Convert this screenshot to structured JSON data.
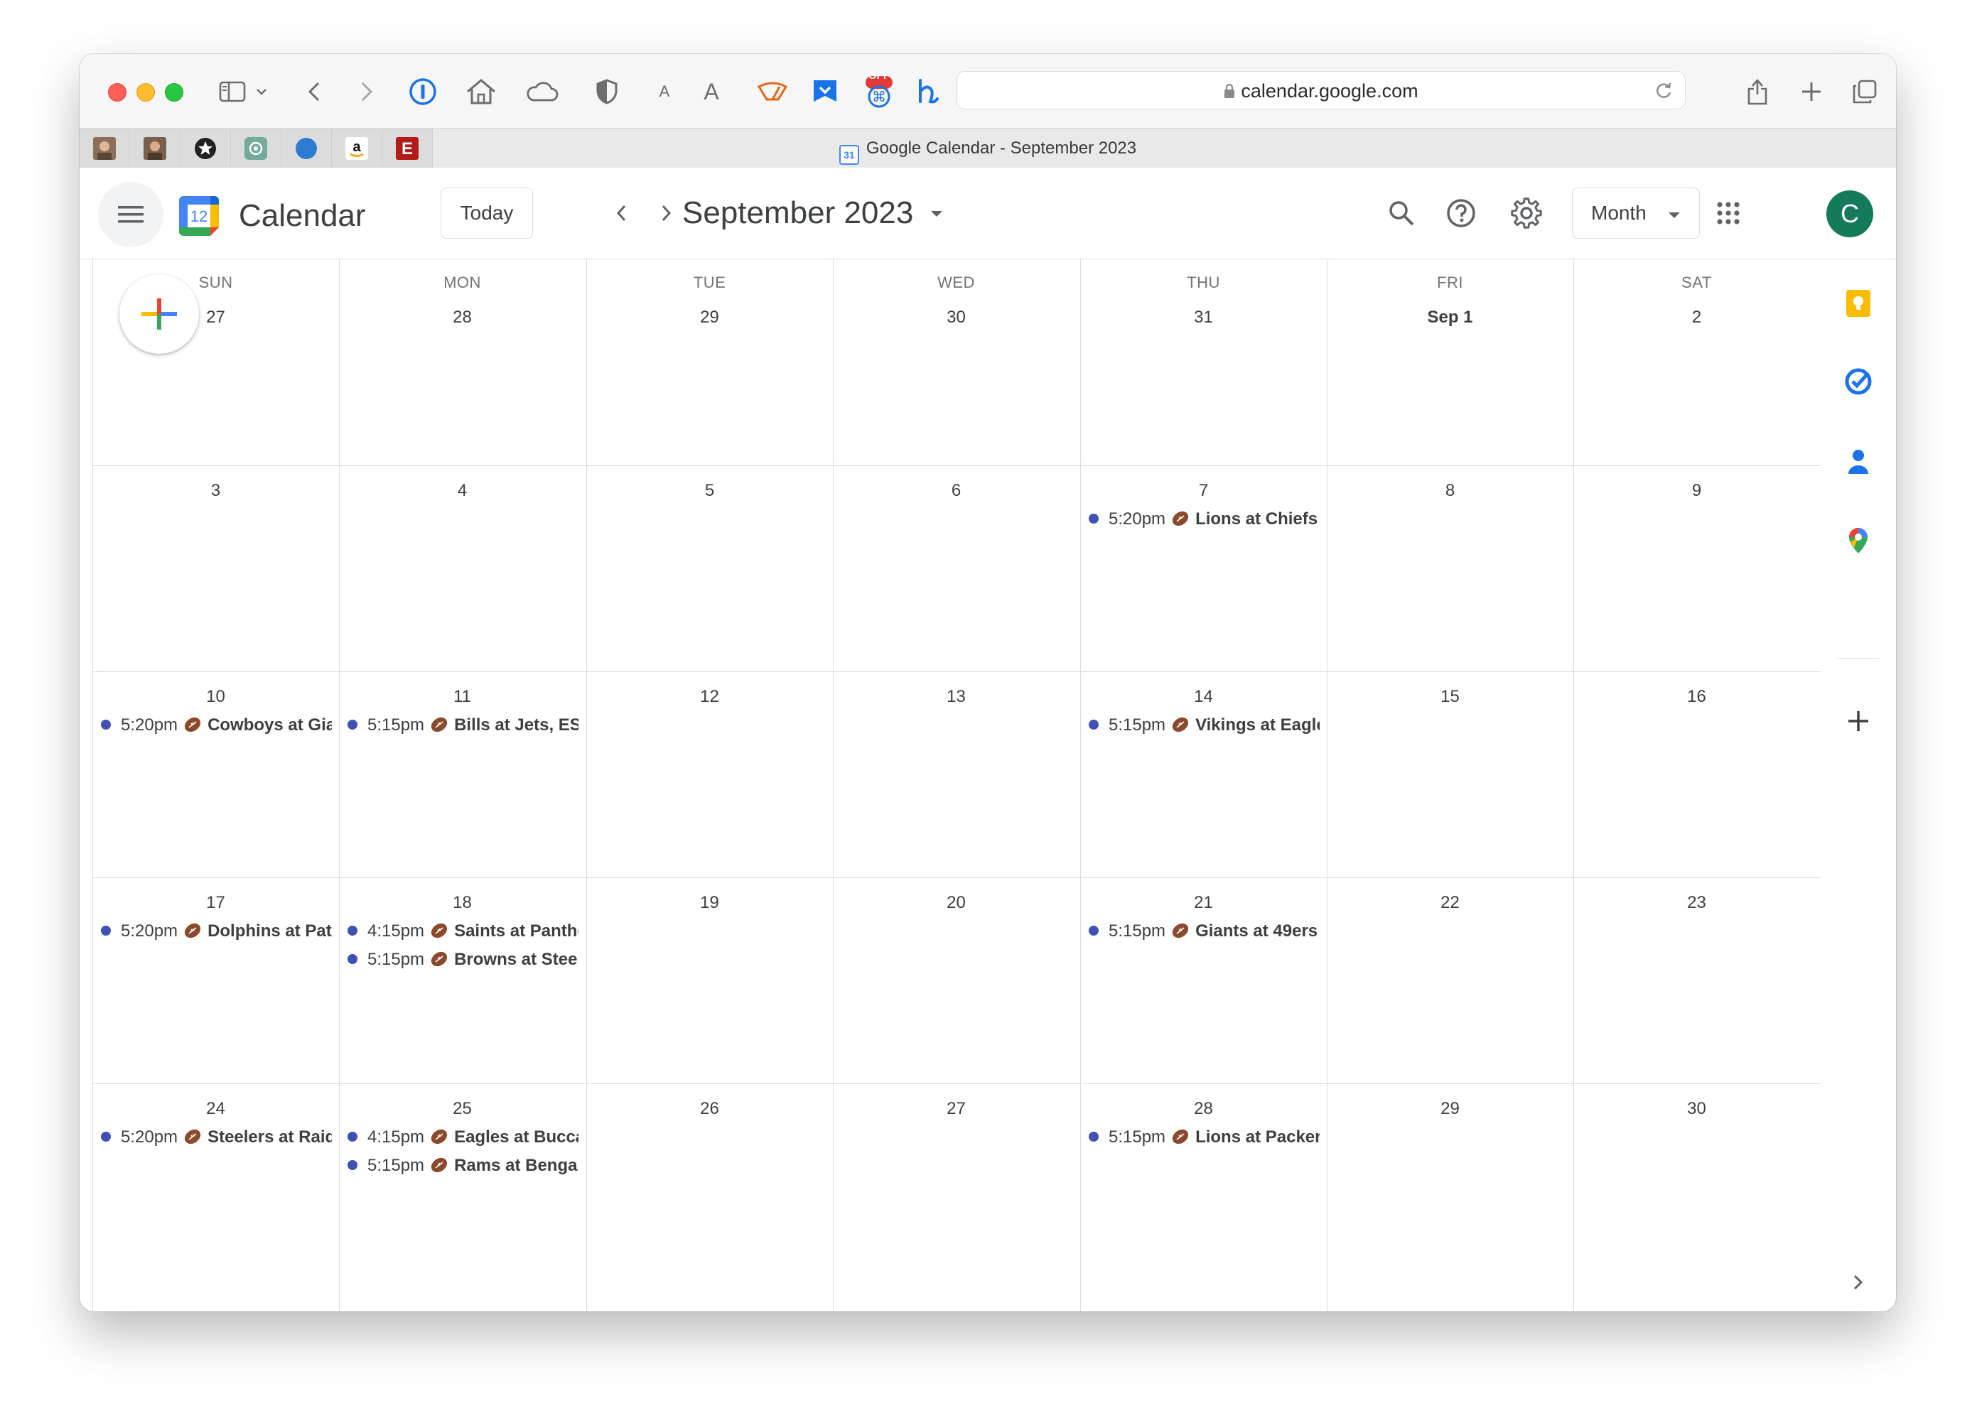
{
  "browser": {
    "url": "calendar.google.com",
    "tab_title": "Google Calendar - September 2023",
    "favicon_text": "31",
    "badge_off": "OFF",
    "reader_small": "A",
    "reader_large": "A",
    "pinned_tabs": [
      "avatar-1",
      "avatar-2",
      "star",
      "openai",
      "blue-circle",
      "amazon",
      "espn"
    ]
  },
  "header": {
    "app_title": "Calendar",
    "logo_number": "12",
    "today_label": "Today",
    "month_title": "September 2023",
    "view_label": "Month",
    "avatar_letter": "C"
  },
  "weekdays": [
    "SUN",
    "MON",
    "TUE",
    "WED",
    "THU",
    "FRI",
    "SAT"
  ],
  "weeks": [
    [
      "27",
      "28",
      "29",
      "30",
      "31",
      "Sep 1",
      "2"
    ],
    [
      "3",
      "4",
      "5",
      "6",
      "7",
      "8",
      "9"
    ],
    [
      "10",
      "11",
      "12",
      "13",
      "14",
      "15",
      "16"
    ],
    [
      "17",
      "18",
      "19",
      "20",
      "21",
      "22",
      "23"
    ],
    [
      "24",
      "25",
      "26",
      "27",
      "28",
      "29",
      "30"
    ]
  ],
  "events": [
    {
      "week": 1,
      "day": 4,
      "slot": 0,
      "time": "5:20pm",
      "title": "Lions at Chiefs"
    },
    {
      "week": 2,
      "day": 0,
      "slot": 0,
      "time": "5:20pm",
      "title": "Cowboys at Giants"
    },
    {
      "week": 2,
      "day": 1,
      "slot": 0,
      "time": "5:15pm",
      "title": "Bills at Jets, ESPN"
    },
    {
      "week": 2,
      "day": 4,
      "slot": 0,
      "time": "5:15pm",
      "title": "Vikings at Eagles"
    },
    {
      "week": 3,
      "day": 0,
      "slot": 0,
      "time": "5:20pm",
      "title": "Dolphins at Patriots"
    },
    {
      "week": 3,
      "day": 1,
      "slot": 0,
      "time": "4:15pm",
      "title": "Saints at Panthers"
    },
    {
      "week": 3,
      "day": 1,
      "slot": 1,
      "time": "5:15pm",
      "title": "Browns at Steelers"
    },
    {
      "week": 3,
      "day": 4,
      "slot": 0,
      "time": "5:15pm",
      "title": "Giants at 49ers"
    },
    {
      "week": 4,
      "day": 0,
      "slot": 0,
      "time": "5:20pm",
      "title": "Steelers at Raiders"
    },
    {
      "week": 4,
      "day": 1,
      "slot": 0,
      "time": "4:15pm",
      "title": "Eagles at Buccaneers"
    },
    {
      "week": 4,
      "day": 1,
      "slot": 1,
      "time": "5:15pm",
      "title": "Rams at Bengals"
    },
    {
      "week": 4,
      "day": 4,
      "slot": 0,
      "time": "5:15pm",
      "title": "Lions at Packers"
    }
  ],
  "event_emoji": "football-icon",
  "event_color": "#3f51b5",
  "side_panel": [
    "keep-icon",
    "tasks-icon",
    "contacts-icon",
    "maps-icon",
    "add-icon",
    "expand-icon"
  ],
  "colors": {
    "avatar_bg": "#137a5a",
    "grid_line": "#dadce0",
    "text": "#3c4043",
    "muted": "#70757a"
  }
}
